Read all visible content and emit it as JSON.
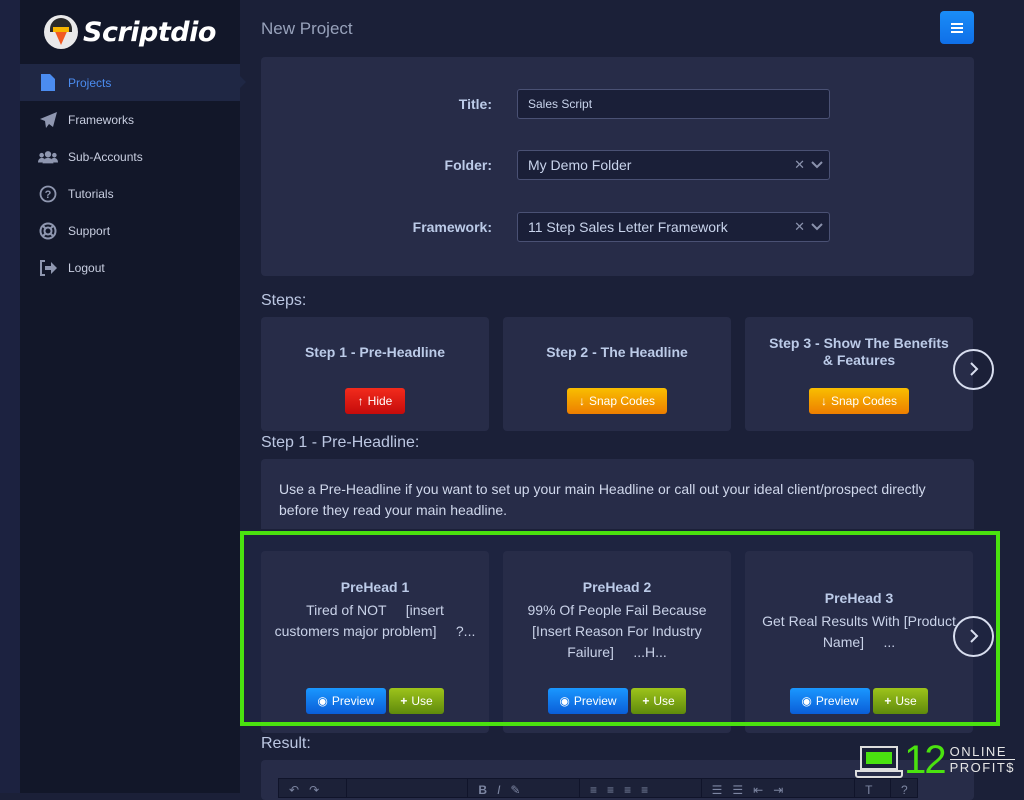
{
  "app": {
    "name": "Scriptdio"
  },
  "sidebar": {
    "items": [
      {
        "label": "Projects",
        "icon": "file-icon",
        "active": true
      },
      {
        "label": "Frameworks",
        "icon": "paper-plane-icon",
        "active": false
      },
      {
        "label": "Sub-Accounts",
        "icon": "users-icon",
        "active": false
      },
      {
        "label": "Tutorials",
        "icon": "question-circle-icon",
        "active": false
      },
      {
        "label": "Support",
        "icon": "life-ring-icon",
        "active": false
      },
      {
        "label": "Logout",
        "icon": "sign-out-icon",
        "active": false
      }
    ]
  },
  "header": {
    "title": "New Project",
    "menu_icon": "hamburger-icon"
  },
  "form": {
    "title_label": "Title:",
    "title_value": "Sales Script",
    "folder_label": "Folder:",
    "folder_value": "My Demo Folder",
    "framework_label": "Framework:",
    "framework_value": "11 Step Sales Letter Framework"
  },
  "steps": {
    "heading": "Steps:",
    "items": [
      {
        "title": "Step 1 - Pre-Headline",
        "button": "Hide",
        "button_icon": "arrow-up-icon",
        "color": "#e01a12"
      },
      {
        "title": "Step 2 - The Headline",
        "button": "Snap Codes",
        "button_icon": "arrow-down-icon",
        "color": "#f39c00"
      },
      {
        "title": "Step 3 - Show The Benefits & Features",
        "button": "Snap Codes",
        "button_icon": "arrow-down-icon",
        "color": "#f39c00"
      }
    ]
  },
  "current_step": {
    "heading": "Step 1 - Pre-Headline:",
    "description": "Use a Pre-Headline if you want to set up your main Headline or call out your ideal client/prospect directly before they read your main headline."
  },
  "preheads": [
    {
      "title": "PreHead 1",
      "body": "Tired of NOT     [insert customers major problem]     ?...",
      "preview": "Preview",
      "use": "Use"
    },
    {
      "title": "PreHead 2",
      "body": "99% Of People Fail Because     [Insert Reason For Industry Failure]     ...H...",
      "preview": "Preview",
      "use": "Use"
    },
    {
      "title": "PreHead 3",
      "body": "Get Real Results With [Product Name]     ...",
      "preview": "Preview",
      "use": "Use"
    }
  ],
  "result": {
    "heading": "Result:"
  },
  "watermark": {
    "number": "12",
    "line1": "ONLINE",
    "line2": "PROFIT$"
  },
  "colors": {
    "highlight": "#4ae20f",
    "accent": "#4b8cf0"
  }
}
